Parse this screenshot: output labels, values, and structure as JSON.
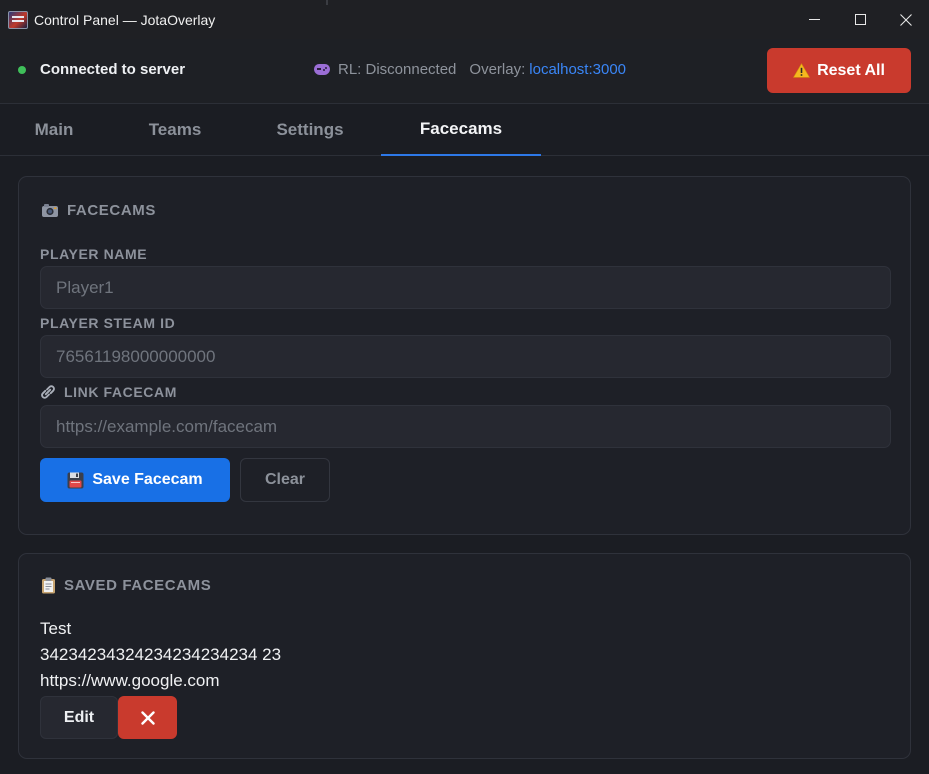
{
  "window": {
    "title": "Control Panel — JotaOverlay"
  },
  "status": {
    "connection": "Connected to server",
    "rl_status": "RL: Disconnected",
    "overlay_label": "Overlay:",
    "overlay_url": "localhost:3000",
    "reset_label": "Reset All",
    "connection_color": "#3fbf5a"
  },
  "tabs": [
    {
      "label": "Main",
      "active": false
    },
    {
      "label": "Teams",
      "active": false
    },
    {
      "label": "Settings",
      "active": false
    },
    {
      "label": "Facecams",
      "active": true
    }
  ],
  "facecams_panel": {
    "title": "Facecams",
    "player_name_label": "Player Name",
    "player_name_placeholder": "Player1",
    "steam_id_label": "Player Steam ID",
    "steam_id_placeholder": "76561198000000000",
    "link_label": "Link Facecam",
    "link_placeholder": "https://example.com/facecam",
    "save_label": "Save Facecam",
    "clear_label": "Clear"
  },
  "saved_panel": {
    "title": "Saved Facecams",
    "entries": [
      {
        "name": "Test",
        "steam_id": "34234234324234234234234 23",
        "link": "https://www.google.com",
        "edit_label": "Edit"
      }
    ]
  },
  "icons": {
    "app": "app-logo-icon",
    "connection": "status-dot-icon",
    "rl": "gamepad-icon",
    "reset": "warning-icon",
    "facecams": "camera-icon",
    "link": "link-icon",
    "save": "floppy-disk-icon",
    "saved": "clipboard-icon",
    "delete": "close-x-icon"
  },
  "colors": {
    "accent": "#1870e6",
    "danger": "#c93a2d",
    "link": "#3a86f7"
  }
}
